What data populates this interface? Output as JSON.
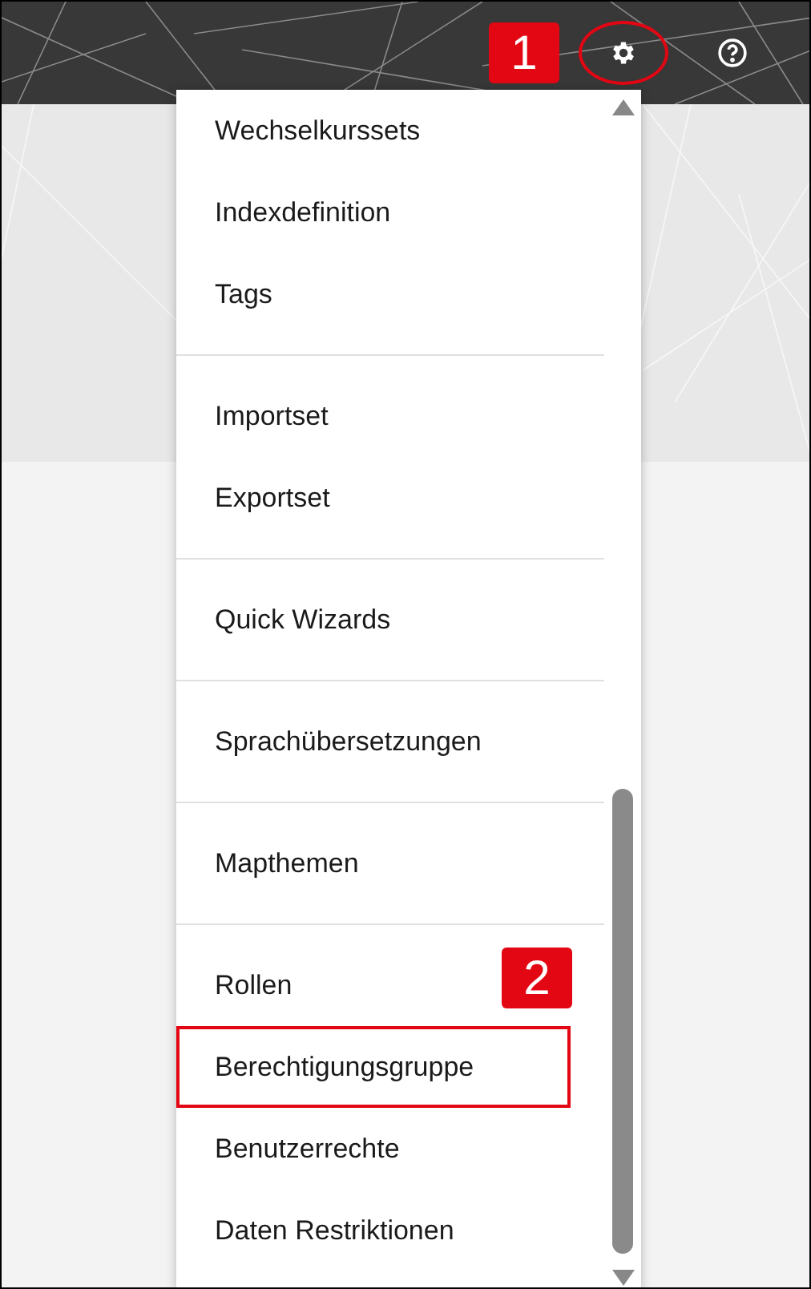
{
  "header": {
    "settings_marked": true
  },
  "annotation_badges": [
    "1",
    "2"
  ],
  "menu": {
    "groups": [
      {
        "items": [
          {
            "label": "Wechselkurssets",
            "highlighted": false
          },
          {
            "label": "Indexdefinition",
            "highlighted": false
          },
          {
            "label": "Tags",
            "highlighted": false
          }
        ]
      },
      {
        "items": [
          {
            "label": "Importset",
            "highlighted": false
          },
          {
            "label": "Exportset",
            "highlighted": false
          }
        ]
      },
      {
        "items": [
          {
            "label": "Quick Wizards",
            "highlighted": false
          }
        ]
      },
      {
        "items": [
          {
            "label": "Sprachübersetzungen",
            "highlighted": false
          }
        ]
      },
      {
        "items": [
          {
            "label": "Mapthemen",
            "highlighted": false
          }
        ]
      },
      {
        "items": [
          {
            "label": "Rollen",
            "highlighted": false
          },
          {
            "label": "Berechtigungsgruppe",
            "highlighted": true
          },
          {
            "label": "Benutzerrechte",
            "highlighted": false
          },
          {
            "label": "Daten Restriktionen",
            "highlighted": false
          }
        ]
      }
    ]
  }
}
